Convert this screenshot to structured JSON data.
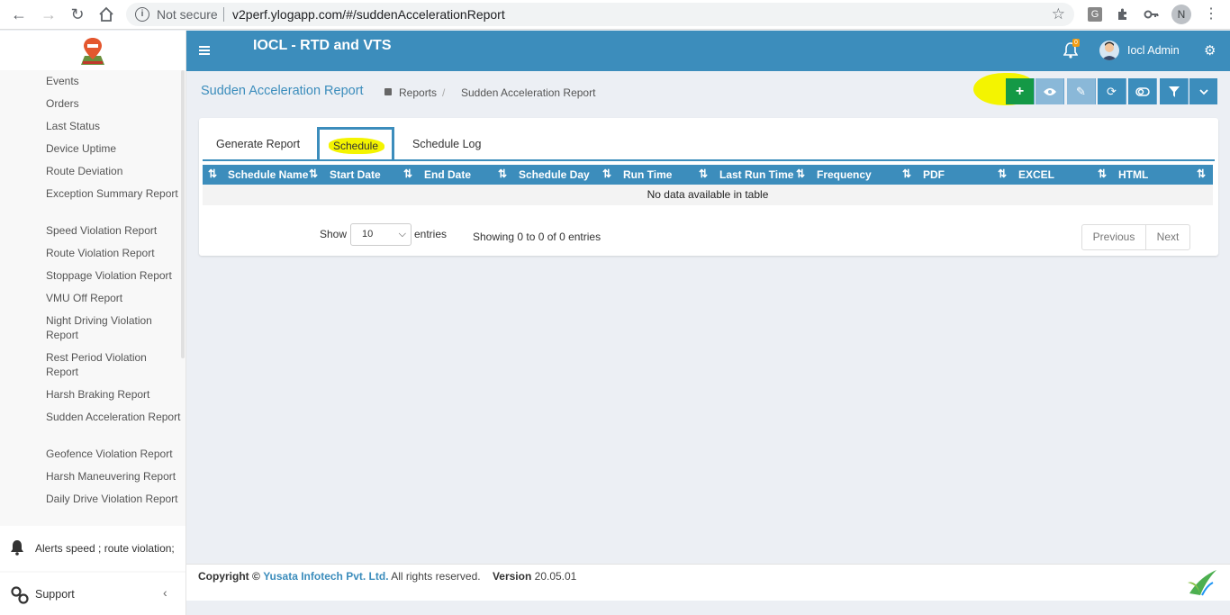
{
  "browser": {
    "security": "Not secure",
    "url": "v2perf.ylogapp.com/#/suddenAccelerationReport",
    "profile_initial": "N",
    "ext_g": "G"
  },
  "sidebar": {
    "items": [
      {
        "label": "Events"
      },
      {
        "label": "Orders"
      },
      {
        "label": "Last Status"
      },
      {
        "label": "Device Uptime"
      },
      {
        "label": "Route Deviation"
      },
      {
        "label": "Exception Summary Report"
      },
      {
        "label": "Speed Violation Report"
      },
      {
        "label": "Route Violation Report"
      },
      {
        "label": "Stoppage Violation Report"
      },
      {
        "label": "VMU Off Report"
      },
      {
        "label": "Night Driving Violation Report"
      },
      {
        "label": "Rest Period Violation Report"
      },
      {
        "label": "Harsh Braking Report"
      },
      {
        "label": "Sudden Acceleration Report"
      },
      {
        "label": "Geofence Violation Report"
      },
      {
        "label": "Harsh Maneuvering Report"
      },
      {
        "label": "Daily Drive Violation Report"
      }
    ],
    "alerts_label": "Alerts speed ; route violation;",
    "support_label": "Support",
    "support_chevron": "‹"
  },
  "header": {
    "app_title": "IOCL - RTD and VTS",
    "notification_count": "0",
    "user_name": "Iocl Admin"
  },
  "page": {
    "title": "Sudden Acceleration Report",
    "breadcrumb_1": "Reports",
    "breadcrumb_sep": "/",
    "breadcrumb_2": "Sudden Acceleration Report"
  },
  "tabs": {
    "generate": "Generate Report",
    "schedule": "Schedule",
    "log": "Schedule Log"
  },
  "table": {
    "columns": [
      "Schedule Name",
      "Start Date",
      "End Date",
      "Schedule Day",
      "Run Time",
      "Last Run Time",
      "Frequency",
      "PDF",
      "EXCEL",
      "HTML"
    ],
    "empty_text": "No data available in table"
  },
  "pagination": {
    "show_label": "Show",
    "page_size": "10",
    "entries_label": "entries",
    "info": "Showing 0 to 0 of 0 entries",
    "previous": "Previous",
    "next": "Next"
  },
  "footer": {
    "copyright_prefix": "Copyright ©",
    "company": "Yusata Infotech Pvt. Ltd.",
    "rights": "All rights reserved.",
    "version_label": "Version",
    "version": "20.05.01"
  },
  "colors": {
    "primary": "#3c8dbc",
    "add_button": "#149946",
    "highlight": "#f4f400"
  }
}
